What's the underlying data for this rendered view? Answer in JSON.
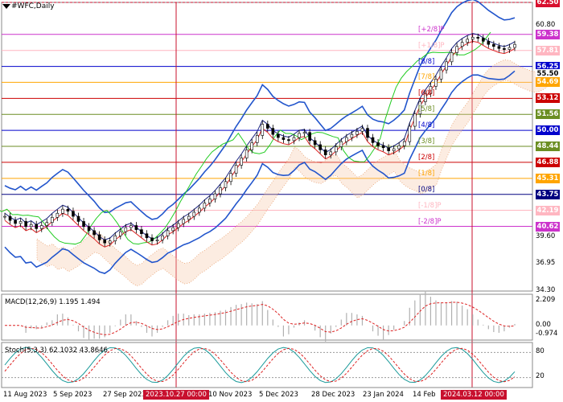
{
  "header": {
    "title": "#WFC,Daily"
  },
  "indicators": {
    "macd": {
      "label": "MACD(12,26,9) 1.195 1.494",
      "ticks": [
        "2.209",
        "0.00",
        "-0.974"
      ]
    },
    "stoch": {
      "label": "Stoch(5,3,3) 62.1032 43.8646",
      "ticks": [
        "80",
        "20"
      ]
    }
  },
  "price_axis": {
    "plain_ticks": [
      "60.80",
      "39.60",
      "36.95",
      "34.30"
    ],
    "tags": [
      {
        "value": "62.50",
        "color": "#d8102e"
      },
      {
        "value": "59.38",
        "color": "#cc33cc"
      },
      {
        "value": "57.81",
        "color": "#ffb6c1"
      },
      {
        "value": "56.25",
        "color": "#0000cc"
      },
      {
        "value": "55.50",
        "color": "#ffffff"
      },
      {
        "value": "54.69",
        "color": "#ffa500"
      },
      {
        "value": "53.12",
        "color": "#cc0000"
      },
      {
        "value": "51.56",
        "color": "#6b8e23"
      },
      {
        "value": "50.00",
        "color": "#0000cc"
      },
      {
        "value": "48.44",
        "color": "#6b8e23"
      },
      {
        "value": "46.88",
        "color": "#cc0000"
      },
      {
        "value": "45.31",
        "color": "#ffa500"
      },
      {
        "value": "43.75",
        "color": "#000080"
      },
      {
        "value": "42.19",
        "color": "#ffb6c1"
      },
      {
        "value": "40.62",
        "color": "#cc33cc"
      }
    ]
  },
  "murray_labels": [
    "[+2/8]P",
    "[+1/8]P",
    "[8/8]",
    "[7/8]",
    "[6/8]",
    "[5/8]",
    "[4/8]",
    "[3/8]",
    "[2/8]",
    "[1/8]",
    "[0/8]",
    "[-1/8]P",
    "[-2/8]P"
  ],
  "time_axis": {
    "labels": [
      "11 Aug 2023",
      "5 Sep 2023",
      "27 Sep 2023",
      "10 Nov 2023",
      "5 Dec 2023",
      "28 Dec 2023",
      "23 Jan 2024",
      "14 Feb"
    ],
    "highlights": [
      "2023.10.27 00:00",
      "2024.03.12 00:00"
    ]
  },
  "chart_data": {
    "type": "line",
    "symbol": "#WFC",
    "timeframe": "Daily",
    "ylim": [
      34.3,
      62.5
    ],
    "murray_levels": [
      {
        "label": "[+2/8]P",
        "value": 59.38
      },
      {
        "label": "[+1/8]P",
        "value": 57.81
      },
      {
        "label": "[8/8]",
        "value": 56.25
      },
      {
        "label": "[7/8]",
        "value": 54.69
      },
      {
        "label": "[6/8]",
        "value": 53.12
      },
      {
        "label": "[5/8]",
        "value": 51.56
      },
      {
        "label": "[4/8]",
        "value": 50.0
      },
      {
        "label": "[3/8]",
        "value": 48.44
      },
      {
        "label": "[2/8]",
        "value": 46.88
      },
      {
        "label": "[1/8]",
        "value": 45.31
      },
      {
        "label": "[0/8]",
        "value": 43.75
      },
      {
        "label": "[-1/8]P",
        "value": 42.19
      },
      {
        "label": "[-2/8]P",
        "value": 40.62
      }
    ],
    "price_series": [
      41.6,
      41.2,
      40.9,
      41.1,
      40.6,
      40.8,
      40.4,
      40.7,
      41.0,
      41.5,
      41.9,
      42.3,
      42.1,
      41.6,
      41.1,
      40.6,
      40.2,
      39.8,
      39.3,
      39.0,
      39.2,
      39.7,
      40.1,
      40.5,
      40.7,
      40.3,
      39.9,
      39.5,
      39.2,
      39.3,
      39.7,
      40.2,
      40.5,
      40.9,
      41.3,
      41.6,
      42.0,
      42.4,
      42.9,
      43.3,
      43.8,
      44.4,
      45.0,
      45.8,
      46.6,
      47.3,
      48.1,
      48.8,
      49.5,
      50.6,
      50.2,
      49.6,
      49.3,
      49.1,
      49.0,
      49.3,
      49.7,
      49.8,
      49.0,
      48.6,
      48.1,
      47.6,
      47.9,
      48.4,
      48.9,
      49.3,
      49.6,
      49.9,
      50.2,
      49.3,
      48.8,
      48.5,
      48.3,
      48.0,
      48.2,
      48.5,
      48.9,
      50.4,
      51.6,
      52.8,
      53.6,
      54.3,
      55.0,
      55.9,
      56.7,
      57.6,
      58.2,
      58.6,
      58.9,
      59.1,
      59.0,
      58.7,
      58.4,
      58.2,
      58.0,
      57.9,
      58.1,
      58.4
    ],
    "macd": {
      "label": "MACD(12,26,9)",
      "main": 1.195,
      "signal": 1.494,
      "range": [
        -0.974,
        2.209
      ]
    },
    "stoch": {
      "label": "Stoch(5,3,3)",
      "k": 62.1032,
      "d": 43.8646,
      "levels": [
        20,
        80
      ]
    }
  }
}
